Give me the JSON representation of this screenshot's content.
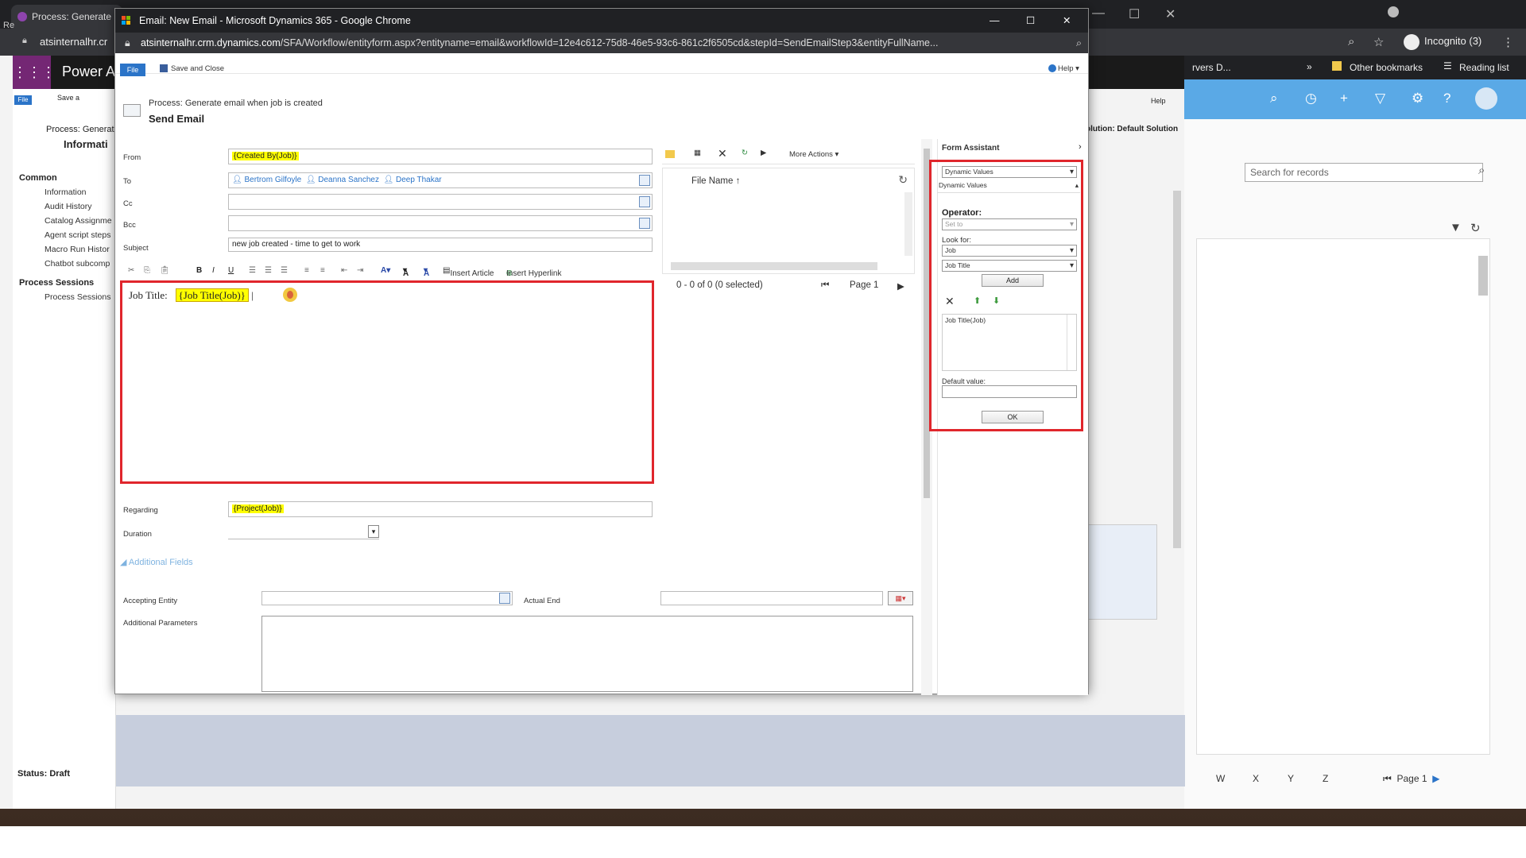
{
  "back_window": {
    "tab_title": "Process: Generate",
    "address_url": "atsinternalhr.cr",
    "incognito_label": "Incognito (3)",
    "bookmarks_more": "»",
    "bookmark_drivers": "rvers D...",
    "bookmark_other": "Other bookmarks",
    "bookmark_reading": "Reading list",
    "powerapps_title": "Power A",
    "left_process": "Process: Generat",
    "left_information": "Informati",
    "file_label": "File",
    "save_label": "Save a",
    "help_label": "Help",
    "solution_label": "olution: Default Solution",
    "search_placeholder": "Search for records",
    "status_label": "Status: Draft",
    "letters": [
      "W",
      "X",
      "Y",
      "Z"
    ],
    "page_label": "Page 1",
    "left_r": "Re",
    "sidebar": {
      "common_header": "Common",
      "common_items": [
        "Information",
        "Audit History",
        "Catalog Assignme",
        "Agent script steps",
        "Macro Run Histor",
        "Chatbot subcomp"
      ],
      "sessions_header": "Process Sessions",
      "sessions_items": [
        "Process Sessions"
      ]
    }
  },
  "popup": {
    "window_title": "Email: New Email - Microsoft Dynamics 365 - Google Chrome",
    "url_host": "atsinternalhr.crm.dynamics.com",
    "url_path": "/SFA/Workflow/entityform.aspx?entityname=email&workflowId=12e4c612-75d8-46e5-93c6-861c2f6505cd&stepId=SendEmailStep3&entityFullName...",
    "ribbon": {
      "file": "File",
      "save_close": "Save and Close",
      "help": "Help"
    },
    "process_name": "Process: Generate email when job is created",
    "step_title": "Send Email",
    "fields": {
      "from_label": "From",
      "from_value": "{Created By(Job)}",
      "to_label": "To",
      "to_recipients": [
        "Bertrom Gilfoyle",
        "Deanna Sanchez",
        "Deep Thakar"
      ],
      "cc_label": "Cc",
      "bcc_label": "Bcc",
      "subject_label": "Subject",
      "subject_value": "new job created - time to get to work",
      "regarding_label": "Regarding",
      "regarding_value": "{Project(Job)}",
      "duration_label": "Duration",
      "additional_fields": "Additional Fields",
      "accepting_entity_label": "Accepting Entity",
      "actual_end_label": "Actual End",
      "additional_params_label": "Additional Parameters"
    },
    "editor_toolbar": {
      "bold": "B",
      "italic": "I",
      "underline": "U",
      "insert_article": "Insert Article",
      "insert_hyperlink": "Insert Hyperlink",
      "font_size": "A",
      "font_color": "A"
    },
    "editor_body": {
      "label": "Job Title:",
      "token": "{Job Title(Job)}"
    },
    "attachments": {
      "more_actions": "More Actions",
      "column": "File Name",
      "count": "0 - 0 of 0 (0 selected)",
      "page": "Page 1"
    },
    "form_assistant": {
      "title": "Form Assistant",
      "dynamic_select": "Dynamic Values",
      "dynamic_header": "Dynamic Values",
      "operator_label": "Operator:",
      "operator_value": "Set to",
      "look_for_label": "Look for:",
      "look_for_entity": "Job",
      "look_for_field": "Job Title",
      "add_button": "Add",
      "list_item": "Job Title(Job)",
      "default_label": "Default value:",
      "ok_button": "OK"
    }
  }
}
